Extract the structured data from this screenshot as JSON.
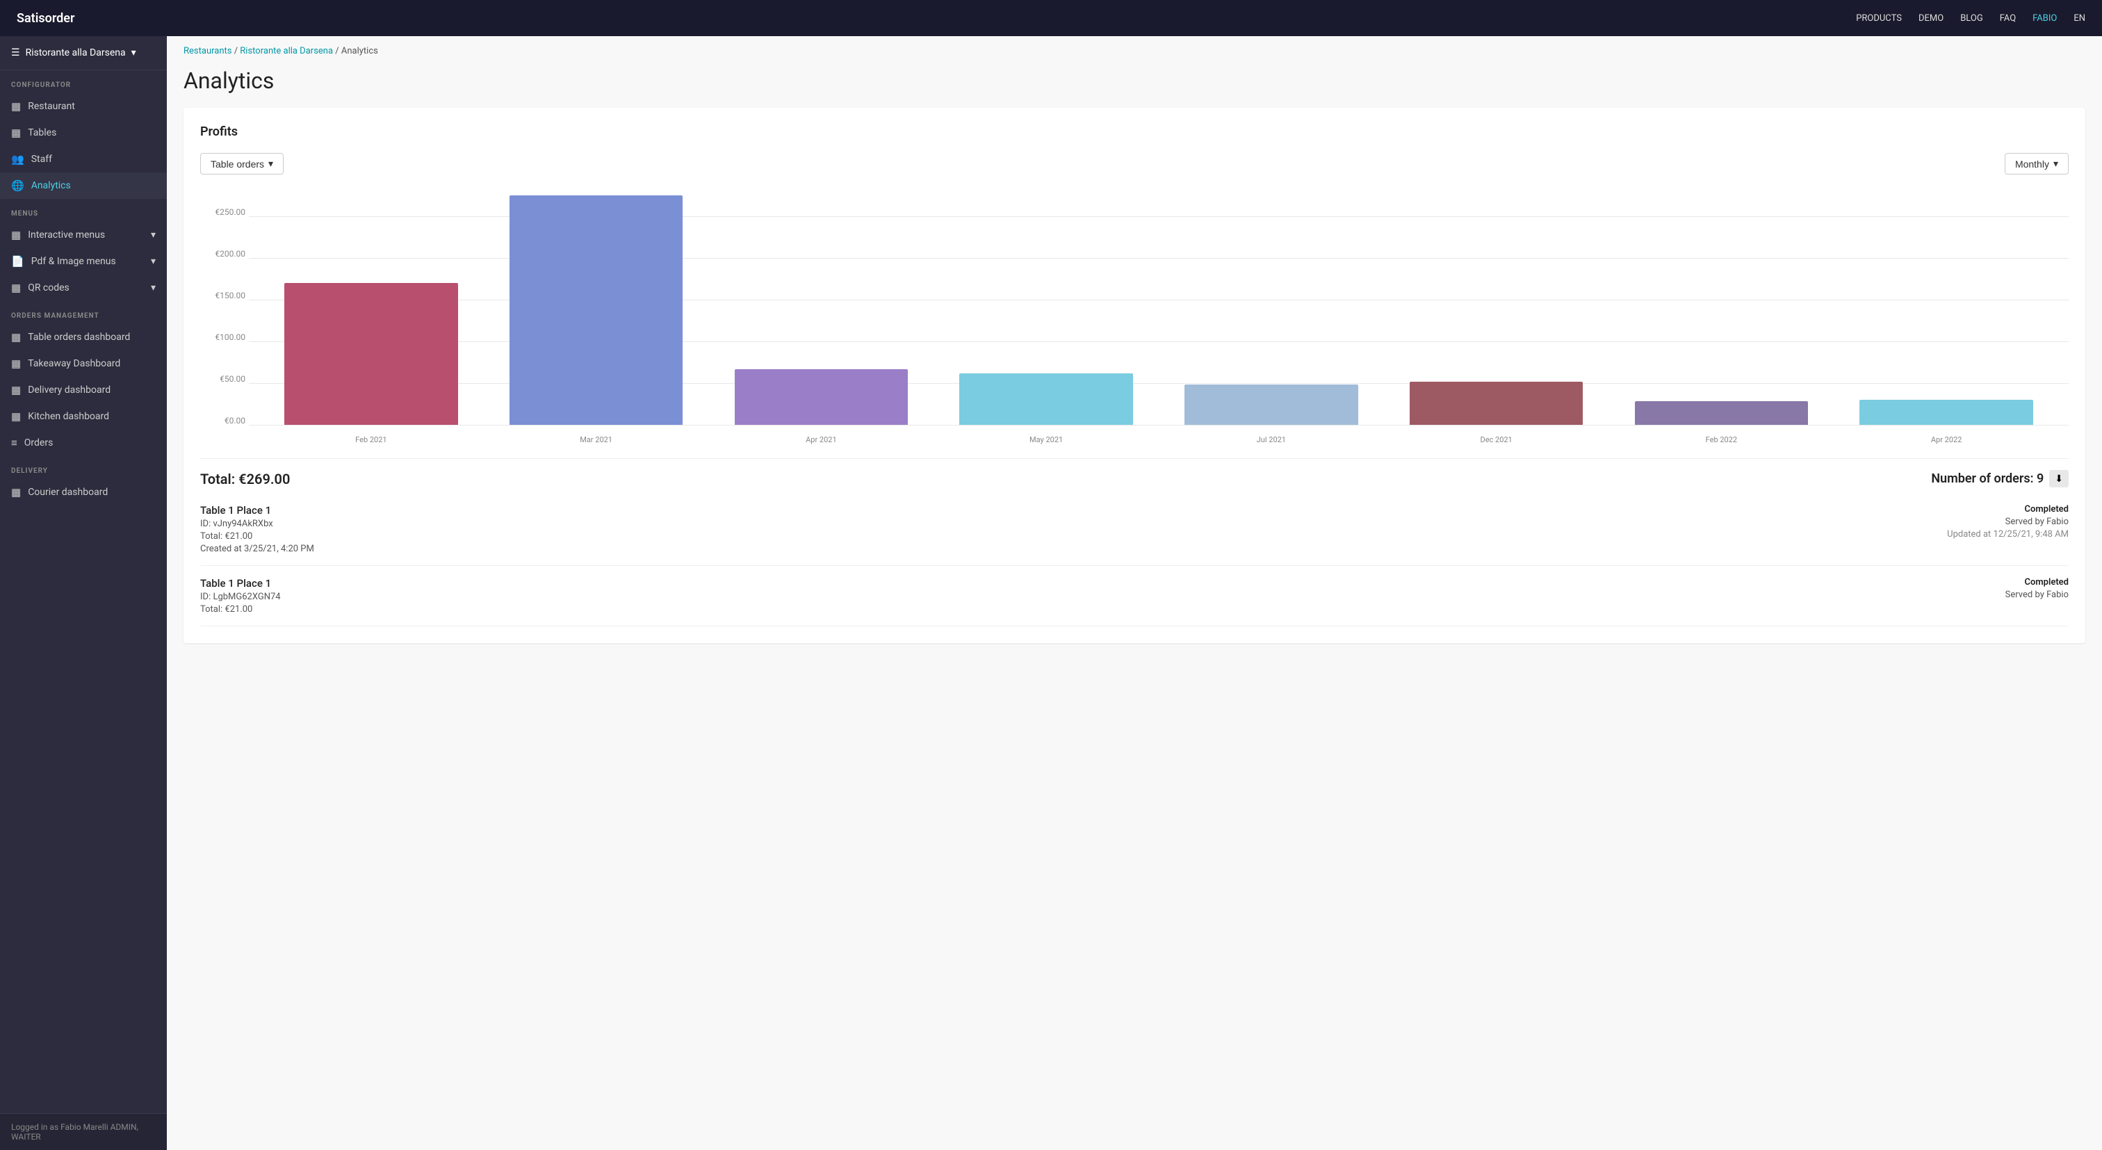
{
  "app": {
    "brand": "Satisorder"
  },
  "topnav": {
    "links": [
      "PRODUCTS",
      "DEMO",
      "BLOG",
      "FAQ",
      "FABIO",
      "EN"
    ],
    "products_label": "PRODUCTS",
    "demo_label": "DEMO",
    "blog_label": "BLOG",
    "faq_label": "FAQ",
    "user_label": "FABIO",
    "lang_label": "EN"
  },
  "sidebar": {
    "restaurant_name": "Ristorante alla Darsena",
    "configurator_label": "CONFIGURATOR",
    "items_configurator": [
      {
        "id": "restaurant",
        "label": "Restaurant",
        "icon": "▦"
      },
      {
        "id": "tables",
        "label": "Tables",
        "icon": "▦"
      },
      {
        "id": "staff",
        "label": "Staff",
        "icon": "👥"
      },
      {
        "id": "analytics",
        "label": "Analytics",
        "icon": "🌐",
        "active": true
      }
    ],
    "menus_label": "MENUS",
    "items_menus": [
      {
        "id": "interactive-menus",
        "label": "Interactive menus",
        "icon": "▦"
      },
      {
        "id": "pdf-image-menus",
        "label": "Pdf & Image menus",
        "icon": "📄"
      },
      {
        "id": "qr-codes",
        "label": "QR codes",
        "icon": "▦"
      }
    ],
    "orders_label": "ORDERS MANAGEMENT",
    "items_orders": [
      {
        "id": "table-orders-dashboard",
        "label": "Table orders dashboard",
        "icon": "▦"
      },
      {
        "id": "takeaway-dashboard",
        "label": "Takeaway Dashboard",
        "icon": "▦"
      },
      {
        "id": "delivery-dashboard",
        "label": "Delivery dashboard",
        "icon": "▦"
      },
      {
        "id": "kitchen-dashboard",
        "label": "Kitchen dashboard",
        "icon": "▦"
      },
      {
        "id": "orders",
        "label": "Orders",
        "icon": "≡"
      }
    ],
    "delivery_label": "DELIVERY",
    "items_delivery": [
      {
        "id": "courier-dashboard",
        "label": "Courier dashboard",
        "icon": "▦"
      }
    ],
    "footer": "Logged in as Fabio Marelli  ADMIN, WAITER"
  },
  "breadcrumb": {
    "restaurants_label": "Restaurants",
    "restaurant_label": "Ristorante alla Darsena",
    "current": "Analytics"
  },
  "page": {
    "title": "Analytics"
  },
  "profits_card": {
    "title": "Profits",
    "filter_label": "Table orders",
    "period_label": "Monthly",
    "chart": {
      "y_labels": [
        "€250.00",
        "€200.00",
        "€150.00",
        "€100.00",
        "€50.00",
        "€0.00"
      ],
      "max": 275,
      "bars": [
        {
          "label": "Feb 2021",
          "value": 170,
          "color": "#b94f6e"
        },
        {
          "label": "Mar 2021",
          "value": 275,
          "color": "#7b8fd4"
        },
        {
          "label": "Apr 2021",
          "value": 67,
          "color": "#9b7ec8"
        },
        {
          "label": "May 2021",
          "value": 62,
          "color": "#7acce0"
        },
        {
          "label": "Jul 2021",
          "value": 48,
          "color": "#a0bcd8"
        },
        {
          "label": "Dec 2021",
          "value": 52,
          "color": "#9e5a62"
        },
        {
          "label": "Feb 2022",
          "value": 28,
          "color": "#8878a8"
        },
        {
          "label": "Apr 2022",
          "value": 30,
          "color": "#7acce0"
        }
      ]
    },
    "total_label": "Total: €269.00",
    "orders_label": "Number of orders: 9"
  },
  "orders": [
    {
      "name": "Table 1 Place 1",
      "id": "ID: vJny94AkRXbx",
      "total": "Total: €21.00",
      "created": "Created at 3/25/21, 4:20 PM",
      "status": "Completed",
      "server": "Served by Fabio",
      "updated": "Updated at 12/25/21, 9:48 AM"
    },
    {
      "name": "Table 1 Place 1",
      "id": "ID: LgbMG62XGN74",
      "total": "Total: €21.00",
      "created": "",
      "status": "Completed",
      "server": "Served by Fabio",
      "updated": ""
    }
  ]
}
